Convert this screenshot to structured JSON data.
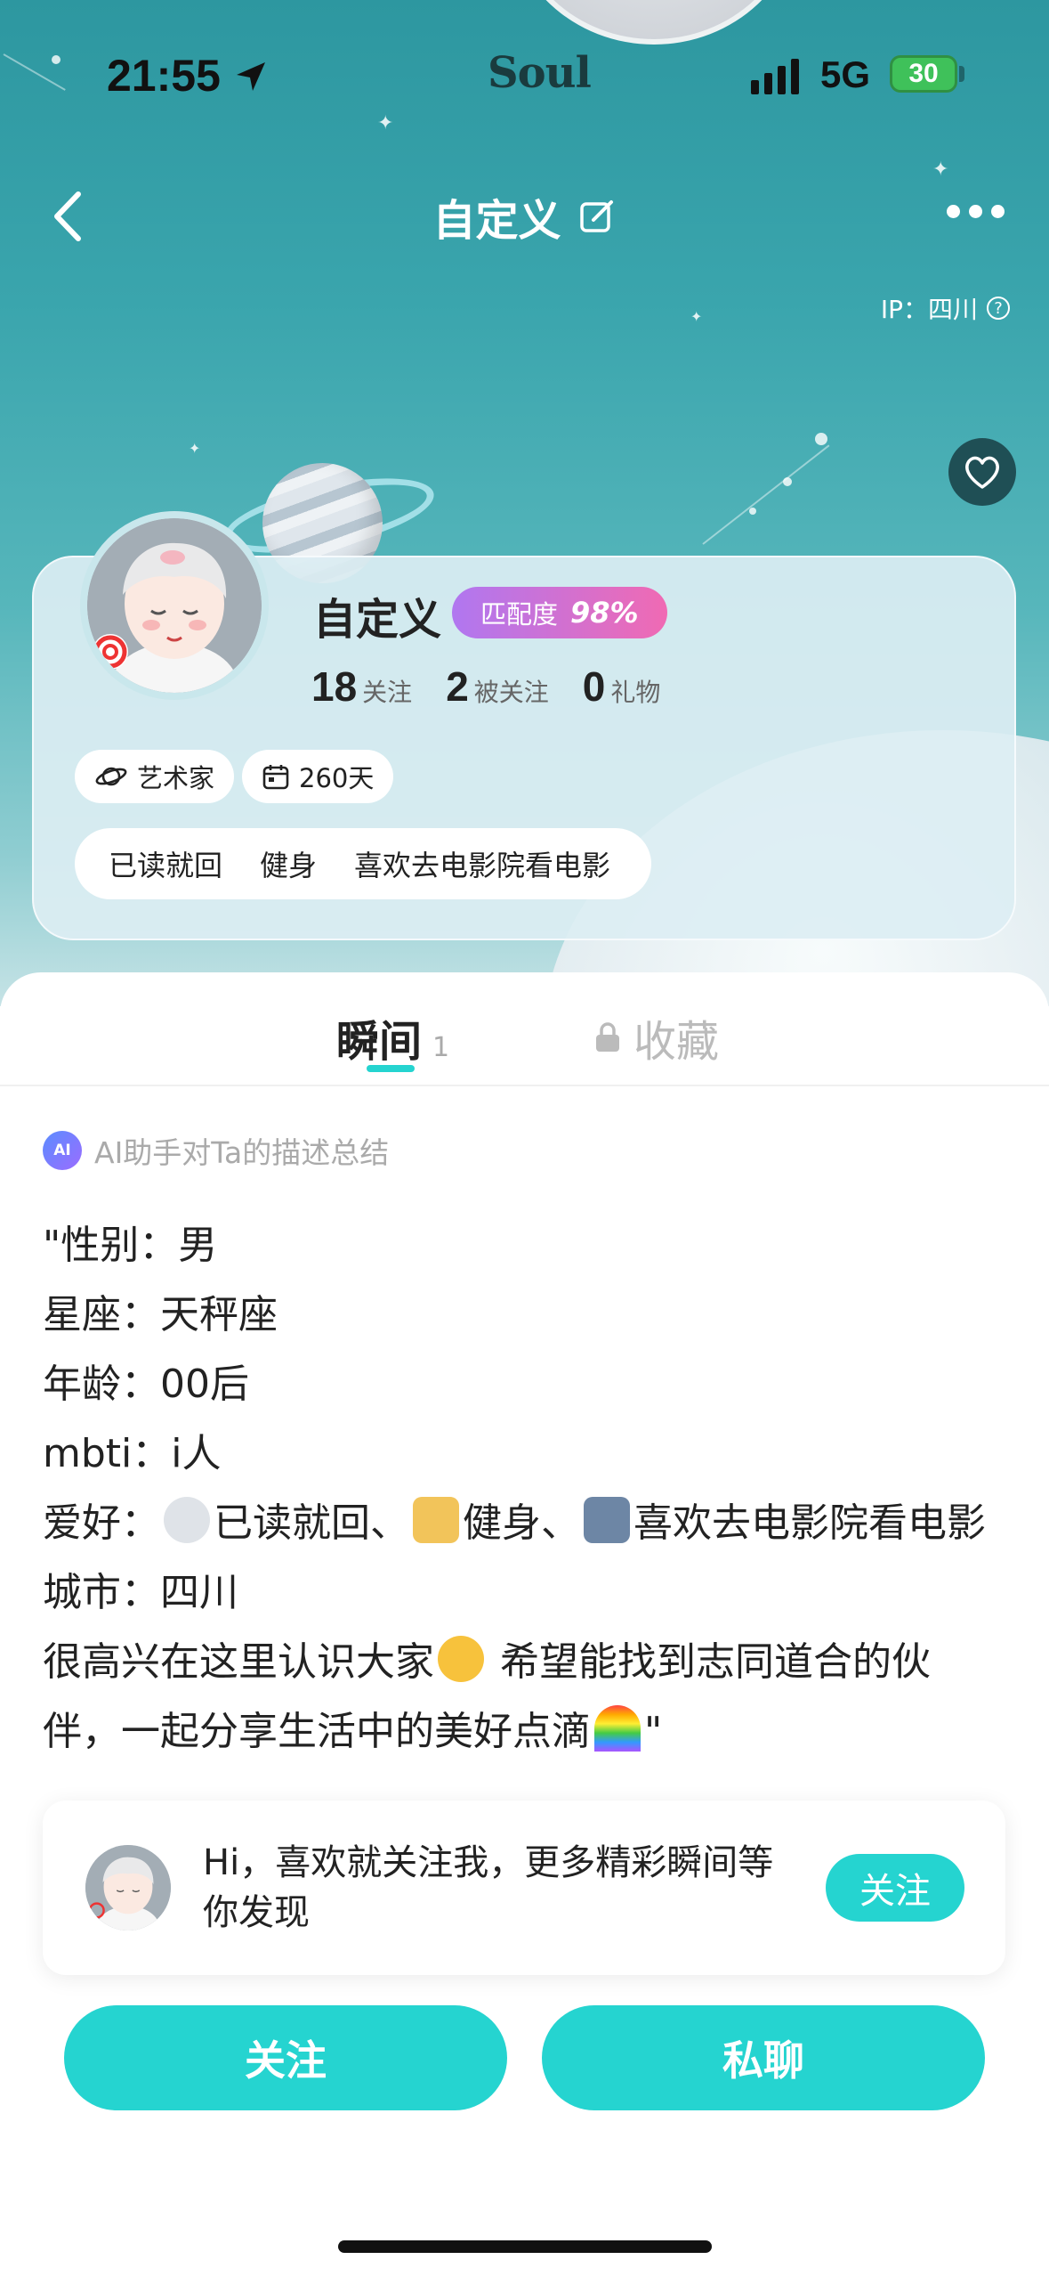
{
  "status_bar": {
    "time": "21:55",
    "app_logo": "Soul",
    "network": "5G",
    "battery": "30"
  },
  "nav": {
    "title": "自定义",
    "ip_label": "IP：四川"
  },
  "profile": {
    "name": "自定义",
    "match_label": "匹配度",
    "match_value": "98%",
    "stats": [
      {
        "num": "18",
        "label": "关注"
      },
      {
        "num": "2",
        "label": "被关注"
      },
      {
        "num": "0",
        "label": "礼物"
      }
    ],
    "chips": [
      {
        "icon": "planet-icon",
        "label": "艺术家"
      },
      {
        "icon": "calendar-icon",
        "label": "260天"
      }
    ],
    "interests": [
      "已读就回",
      "健身",
      "喜欢去电影院看电影"
    ]
  },
  "tabs": {
    "moments_label": "瞬间",
    "moments_count": "1",
    "favorites_label": "收藏"
  },
  "ai_summary": {
    "label": "AI助手对Ta的描述总结",
    "lines": [
      "\"性别：男",
      "星座：天秤座",
      "年龄：00后",
      "mbti：i人"
    ],
    "hobby_prefix": "爱好：",
    "hobby_parts": [
      "已读就回、",
      "健身、",
      "喜欢去电影院看电影"
    ],
    "city_line": "城市：四川",
    "intro_1a": "很高兴在这里认识大家",
    "intro_1b": " 希望能找到志同道合的伙",
    "intro_2a": "伴，一起分享生活中的美好点滴",
    "intro_2b": "\""
  },
  "follow_prompt": {
    "text": "Hi，喜欢就关注我，更多精彩瞬间等你发现",
    "button": "关注"
  },
  "actions": {
    "follow": "关注",
    "chat": "私聊"
  },
  "colors": {
    "accent": "#25d4d0",
    "hero_top": "#2d97a0",
    "match_gradient_start": "#b077f0",
    "match_gradient_end": "#f06ab3"
  }
}
